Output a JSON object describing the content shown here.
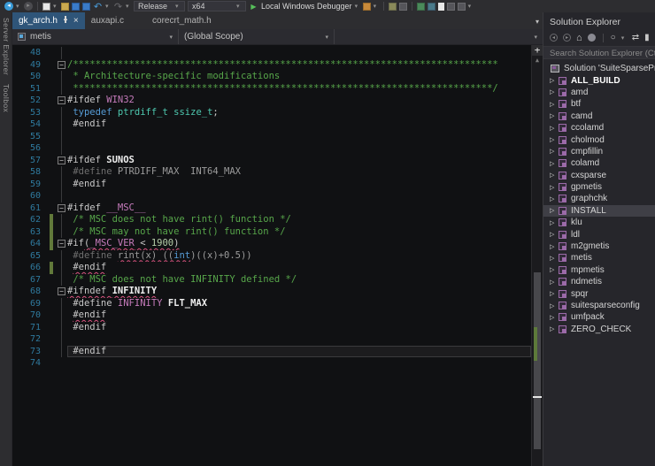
{
  "toolbar": {
    "release_label": "Release",
    "platform_label": "x64",
    "debugger_label": "Local Windows Debugger"
  },
  "side_tabs": [
    "Server Explorer",
    "Toolbox"
  ],
  "tabs": [
    {
      "label": "gk_arch.h",
      "active": true
    },
    {
      "label": "auxapi.c",
      "active": false
    },
    {
      "label": "corecrt_math.h",
      "active": false
    }
  ],
  "navbar": {
    "project": "metis",
    "scope": "(Global Scope)",
    "member": ""
  },
  "colors": {
    "active_tab": "#2f5579",
    "comment": "#57a64a",
    "keyword": "#569cd6",
    "type": "#4ec9b0",
    "macro": "#c57bbb",
    "number": "#b5cea8",
    "squiggle": "#d9537f",
    "change_bar": "#61793a",
    "line_number": "#2f7a9e",
    "editor_bg": "#101113"
  },
  "editor": {
    "lines": [
      {
        "n": 48,
        "segs": []
      },
      {
        "n": 49,
        "fold": true,
        "segs": [
          {
            "t": "/****************************************************************************",
            "c": "com"
          }
        ]
      },
      {
        "n": 50,
        "segs": [
          {
            "t": " * Architecture-specific modifications",
            "c": "com"
          }
        ]
      },
      {
        "n": 51,
        "segs": [
          {
            "t": " ***************************************************************************/",
            "c": "com"
          }
        ]
      },
      {
        "n": 52,
        "fold": true,
        "segs": [
          {
            "t": "#ifdef ",
            "c": "plain"
          },
          {
            "t": "WIN32",
            "c": "macro"
          }
        ]
      },
      {
        "n": 53,
        "segs": [
          {
            "t": " ",
            "c": "plain"
          },
          {
            "t": "typedef",
            "c": "kw"
          },
          {
            "t": " ",
            "c": "plain"
          },
          {
            "t": "ptrdiff_t",
            "c": "type"
          },
          {
            "t": " ",
            "c": "plain"
          },
          {
            "t": "ssize_t",
            "c": "type"
          },
          {
            "t": ";",
            "c": "plain"
          }
        ]
      },
      {
        "n": 54,
        "segs": [
          {
            "t": " #endif",
            "c": "plain"
          }
        ]
      },
      {
        "n": 55,
        "segs": []
      },
      {
        "n": 56,
        "segs": []
      },
      {
        "n": 57,
        "fold": true,
        "segs": [
          {
            "t": "#ifdef ",
            "c": "plain"
          },
          {
            "t": "SUNOS",
            "c": "pb"
          }
        ]
      },
      {
        "n": 58,
        "segs": [
          {
            "t": " #define ",
            "c": "def"
          },
          {
            "t": "PTRDIFF_MAX  INT64_MAX",
            "c": "gray"
          }
        ]
      },
      {
        "n": 59,
        "segs": [
          {
            "t": " #endif",
            "c": "plain"
          }
        ]
      },
      {
        "n": 60,
        "segs": []
      },
      {
        "n": 61,
        "fold": true,
        "segs": [
          {
            "t": "#ifdef ",
            "c": "plain"
          },
          {
            "t": "__MSC__",
            "c": "macro"
          }
        ]
      },
      {
        "n": 62,
        "changed": true,
        "segs": [
          {
            "t": " /* MSC does not have rint() function */",
            "c": "com"
          }
        ]
      },
      {
        "n": 63,
        "changed": true,
        "segs": [
          {
            "t": " /* MSC may not have rint() function */",
            "c": "com"
          }
        ]
      },
      {
        "n": 64,
        "fold": true,
        "changed": true,
        "segs": [
          {
            "t": "#if",
            "c": "plain"
          },
          {
            "t": "(",
            "c": "plain",
            "u": true
          },
          {
            "t": "_MSC_VER",
            "c": "macro",
            "u": true
          },
          {
            "t": " < ",
            "c": "plain",
            "u": true
          },
          {
            "t": "1900",
            "c": "num",
            "u": true
          },
          {
            "t": ")",
            "c": "plain",
            "u": true
          }
        ]
      },
      {
        "n": 65,
        "segs": [
          {
            "t": " #define ",
            "c": "def"
          },
          {
            "t": "rint(x) ((",
            "c": "gray",
            "u": true
          },
          {
            "t": "int",
            "c": "kw",
            "u": true
          },
          {
            "t": ")((x)+0.5))",
            "c": "gray"
          }
        ]
      },
      {
        "n": 66,
        "changed": true,
        "segs": [
          {
            "t": " ",
            "c": "plain"
          },
          {
            "t": "#endif",
            "c": "plain",
            "u": true
          }
        ]
      },
      {
        "n": 67,
        "segs": [
          {
            "t": " /* MSC does not have INFINITY defined */",
            "c": "com"
          }
        ]
      },
      {
        "n": 68,
        "fold": true,
        "segs": [
          {
            "t": "#ifndef ",
            "c": "plain",
            "u": true
          },
          {
            "t": "INFINITY",
            "c": "pb",
            "u": true
          }
        ]
      },
      {
        "n": 69,
        "segs": [
          {
            "t": " #define ",
            "c": "plain"
          },
          {
            "t": "INFINITY",
            "c": "macro"
          },
          {
            "t": " ",
            "c": "plain"
          },
          {
            "t": "FLT_MAX",
            "c": "pb"
          }
        ]
      },
      {
        "n": 70,
        "segs": [
          {
            "t": " ",
            "c": "plain"
          },
          {
            "t": "#endif",
            "c": "plain",
            "u": true
          }
        ]
      },
      {
        "n": 71,
        "segs": [
          {
            "t": " #endif",
            "c": "plain"
          }
        ]
      },
      {
        "n": 72,
        "segs": []
      },
      {
        "n": 73,
        "current": true,
        "segs": [
          {
            "t": " #endif",
            "c": "plain"
          }
        ]
      },
      {
        "n": 74,
        "noguide": true,
        "segs": []
      }
    ]
  },
  "solution_explorer": {
    "title": "Solution Explorer",
    "search_placeholder": "Search Solution Explorer (Ctrl-",
    "solution_label": "Solution 'SuiteSparseProj",
    "projects": [
      {
        "label": "ALL_BUILD",
        "bold": true
      },
      {
        "label": "amd"
      },
      {
        "label": "btf"
      },
      {
        "label": "camd"
      },
      {
        "label": "ccolamd"
      },
      {
        "label": "cholmod"
      },
      {
        "label": "cmpfillin"
      },
      {
        "label": "colamd"
      },
      {
        "label": "cxsparse"
      },
      {
        "label": "gpmetis"
      },
      {
        "label": "graphchk"
      },
      {
        "label": "INSTALL",
        "selected": true
      },
      {
        "label": "klu"
      },
      {
        "label": "ldl"
      },
      {
        "label": "m2gmetis"
      },
      {
        "label": "metis"
      },
      {
        "label": "mpmetis"
      },
      {
        "label": "ndmetis"
      },
      {
        "label": "spqr"
      },
      {
        "label": "suitesparseconfig"
      },
      {
        "label": "umfpack"
      },
      {
        "label": "ZERO_CHECK"
      }
    ]
  }
}
